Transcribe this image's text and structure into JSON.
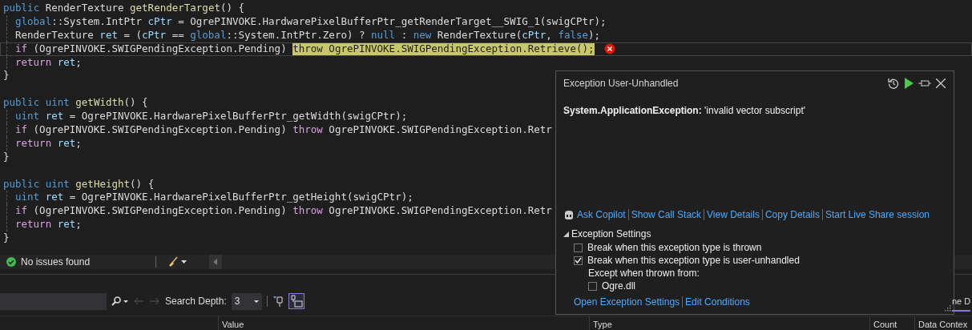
{
  "code": {
    "lines": [
      {
        "kind": "decl",
        "tokens": [
          {
            "text": "public",
            "kind": "kw"
          },
          {
            "text": " RenderTexture ",
            "kind": "p"
          },
          {
            "text": "getRenderTarget",
            "kind": "m"
          },
          {
            "text": "() {",
            "kind": "p"
          }
        ]
      },
      {
        "kind": "body",
        "tokens": [
          {
            "text": "global",
            "kind": "kw"
          },
          {
            "text": "::System.IntPtr ",
            "kind": "p"
          },
          {
            "text": "cPtr",
            "kind": "v"
          },
          {
            "text": " = OgrePINVOKE.HardwarePixelBufferPtr_getRenderTarget__SWIG_1(swigCPtr);",
            "kind": "p"
          }
        ]
      },
      {
        "kind": "body",
        "tokens": [
          {
            "text": "RenderTexture ",
            "kind": "p"
          },
          {
            "text": "ret",
            "kind": "v"
          },
          {
            "text": " = (",
            "kind": "p"
          },
          {
            "text": "cPtr",
            "kind": "v"
          },
          {
            "text": " == ",
            "kind": "p"
          },
          {
            "text": "global",
            "kind": "kw"
          },
          {
            "text": "::System.IntPtr.Zero) ? ",
            "kind": "p"
          },
          {
            "text": "null",
            "kind": "kw"
          },
          {
            "text": " : ",
            "kind": "p"
          },
          {
            "text": "new",
            "kind": "kw"
          },
          {
            "text": " RenderTexture(",
            "kind": "p"
          },
          {
            "text": "cPtr",
            "kind": "v"
          },
          {
            "text": ", ",
            "kind": "p"
          },
          {
            "text": "false",
            "kind": "kw"
          },
          {
            "text": ");",
            "kind": "p"
          }
        ]
      },
      {
        "kind": "body",
        "current": true,
        "error": true,
        "tokens": [
          {
            "text": "if",
            "kind": "c"
          },
          {
            "text": " (OgrePINVOKE.SWIGPendingException.Pending) ",
            "kind": "p"
          },
          {
            "text": "throw OgrePINVOKE.SWIGPendingException.Retrieve();",
            "kind": "hl"
          }
        ]
      },
      {
        "kind": "body",
        "tokens": [
          {
            "text": "return",
            "kind": "c"
          },
          {
            "text": " ret",
            "kind": "v"
          },
          {
            "text": ";",
            "kind": "p"
          }
        ]
      },
      {
        "kind": "decl",
        "tokens": [
          {
            "text": "}",
            "kind": "p"
          }
        ]
      },
      {
        "kind": "blank"
      },
      {
        "kind": "decl",
        "tokens": [
          {
            "text": "public",
            "kind": "kw"
          },
          {
            "text": " uint",
            "kind": "kw"
          },
          {
            "text": " getWidth",
            "kind": "m"
          },
          {
            "text": "() {",
            "kind": "p"
          }
        ]
      },
      {
        "kind": "body",
        "tokens": [
          {
            "text": "uint",
            "kind": "kw"
          },
          {
            "text": " ret",
            "kind": "v"
          },
          {
            "text": " = OgrePINVOKE.HardwarePixelBufferPtr_getWidth(swigCPtr);",
            "kind": "p"
          }
        ]
      },
      {
        "kind": "body",
        "tokens": [
          {
            "text": "if",
            "kind": "c"
          },
          {
            "text": " (OgrePINVOKE.SWIGPendingException.Pending) ",
            "kind": "p"
          },
          {
            "text": "throw",
            "kind": "c"
          },
          {
            "text": " OgrePINVOKE.SWIGPendingException.Retr",
            "kind": "p"
          }
        ]
      },
      {
        "kind": "body",
        "tokens": [
          {
            "text": "return",
            "kind": "c"
          },
          {
            "text": " ret",
            "kind": "v"
          },
          {
            "text": ";",
            "kind": "p"
          }
        ]
      },
      {
        "kind": "decl",
        "tokens": [
          {
            "text": "}",
            "kind": "p"
          }
        ]
      },
      {
        "kind": "blank"
      },
      {
        "kind": "decl",
        "tokens": [
          {
            "text": "public",
            "kind": "kw"
          },
          {
            "text": " uint",
            "kind": "kw"
          },
          {
            "text": " getHeight",
            "kind": "m"
          },
          {
            "text": "() {",
            "kind": "p"
          }
        ]
      },
      {
        "kind": "body",
        "tokens": [
          {
            "text": "uint",
            "kind": "kw"
          },
          {
            "text": " ret",
            "kind": "v"
          },
          {
            "text": " = OgrePINVOKE.HardwarePixelBufferPtr_getHeight(swigCPtr);",
            "kind": "p"
          }
        ]
      },
      {
        "kind": "body",
        "tokens": [
          {
            "text": "if",
            "kind": "c"
          },
          {
            "text": " (OgrePINVOKE.SWIGPendingException.Pending) ",
            "kind": "p"
          },
          {
            "text": "throw",
            "kind": "c"
          },
          {
            "text": " OgrePINVOKE.SWIGPendingException.Retr",
            "kind": "p"
          }
        ]
      },
      {
        "kind": "body",
        "tokens": [
          {
            "text": "return",
            "kind": "c"
          },
          {
            "text": " ret",
            "kind": "v"
          },
          {
            "text": ";",
            "kind": "p"
          }
        ]
      },
      {
        "kind": "decl",
        "tokens": [
          {
            "text": "}",
            "kind": "p"
          }
        ]
      }
    ]
  },
  "status_bar": {
    "text": "No issues found"
  },
  "bottom_panel": {
    "search_depth": {
      "label": "Search Depth:",
      "value": "3"
    },
    "columns": [
      "Value",
      "Type",
      "Count",
      "Data Contex"
    ],
    "side_tab": {
      "label": "ne D",
      "selected": true
    }
  },
  "exception_popup": {
    "title": "Exception User-Unhandled",
    "message": "**System.ApplicationException:** 'invalid vector subscript'",
    "actions": [
      "Ask Copilot",
      "Show Call Stack",
      "View Details",
      "Copy Details",
      "Start Live Share session"
    ],
    "settings": {
      "title": "Exception Settings",
      "expanded": true,
      "options": [
        {
          "label": "Break when this exception type is thrown",
          "checked": false
        },
        {
          "label": "Break when this exception type is user-unhandled",
          "checked": true
        }
      ],
      "except_label": "Except when thrown from:",
      "modules": [
        {
          "label": "Ogre.dll",
          "checked": false
        }
      ]
    },
    "footer_links": [
      "Open Exception Settings",
      "Edit Conditions"
    ]
  }
}
